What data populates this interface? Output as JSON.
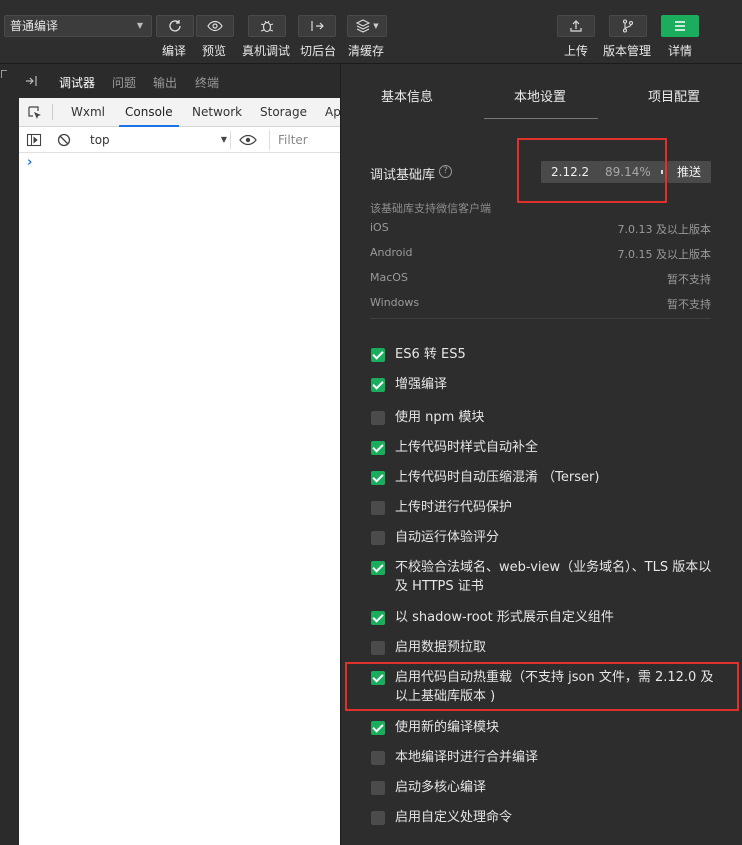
{
  "toolbar": {
    "mode": "普通编译",
    "buttons": [
      {
        "label": "编译",
        "icon": "refresh-icon"
      },
      {
        "label": "预览",
        "icon": "eye-icon"
      },
      {
        "label": "真机调试",
        "icon": "bug-icon"
      },
      {
        "label": "切后台",
        "icon": "switch-icon"
      },
      {
        "label": "清缓存",
        "icon": "layers-icon"
      }
    ],
    "right_buttons": [
      {
        "label": "上传",
        "icon": "upload-icon"
      },
      {
        "label": "版本管理",
        "icon": "branch-icon"
      },
      {
        "label": "详情",
        "icon": "menu-icon"
      }
    ]
  },
  "devtools": {
    "tabs": [
      "调试器",
      "问题",
      "输出",
      "终端"
    ],
    "active_tab": "调试器",
    "panel_tabs": [
      "Wxml",
      "Console",
      "Network",
      "Storage",
      "Ap"
    ],
    "active_panel": "Console",
    "context": "top",
    "filter_placeholder": "Filter",
    "prompt": "›"
  },
  "settings": {
    "tabs": [
      "基本信息",
      "本地设置",
      "项目配置"
    ],
    "active_tab": "本地设置",
    "library_label": "调试基础库",
    "help": "?",
    "version": "2.12.2",
    "version_pct": "89.14%",
    "push_label": "推送",
    "support_note": "该基础库支持微信客户端",
    "support": [
      {
        "os": "iOS",
        "value": "7.0.13 及以上版本"
      },
      {
        "os": "Android",
        "value": "7.0.15 及以上版本"
      },
      {
        "os": "MacOS",
        "value": "暂不支持"
      },
      {
        "os": "Windows",
        "value": "暂不支持"
      }
    ],
    "options": [
      {
        "label": "ES6 转 ES5",
        "checked": true
      },
      {
        "label": "增强编译",
        "checked": true
      },
      {
        "label": "使用 npm 模块",
        "checked": false
      },
      {
        "label": "上传代码时样式自动补全",
        "checked": true
      },
      {
        "label": "上传代码时自动压缩混淆 （Terser)",
        "checked": true
      },
      {
        "label": "上传时进行代码保护",
        "checked": false
      },
      {
        "label": "自动运行体验评分",
        "checked": false
      },
      {
        "label": "不校验合法域名、web-view（业务域名）、TLS 版本以及 HTTPS 证书",
        "checked": true
      },
      {
        "label": "以 shadow-root 形式展示自定义组件",
        "checked": true
      },
      {
        "label": "启用数据预拉取",
        "checked": false
      },
      {
        "label": "启用代码自动热重载（不支持 json 文件，需 2.12.0 及以上基础库版本 )",
        "checked": true
      },
      {
        "label": "使用新的编译模块",
        "checked": true
      },
      {
        "label": "本地编译时进行合并编译",
        "checked": false
      },
      {
        "label": "启动多核心编译",
        "checked": false
      },
      {
        "label": "启用自定义处理命令",
        "checked": false
      }
    ]
  },
  "colors": {
    "accent": "#1aad5e",
    "annotation": "#e0312b",
    "panel": "#2d2d2d"
  }
}
